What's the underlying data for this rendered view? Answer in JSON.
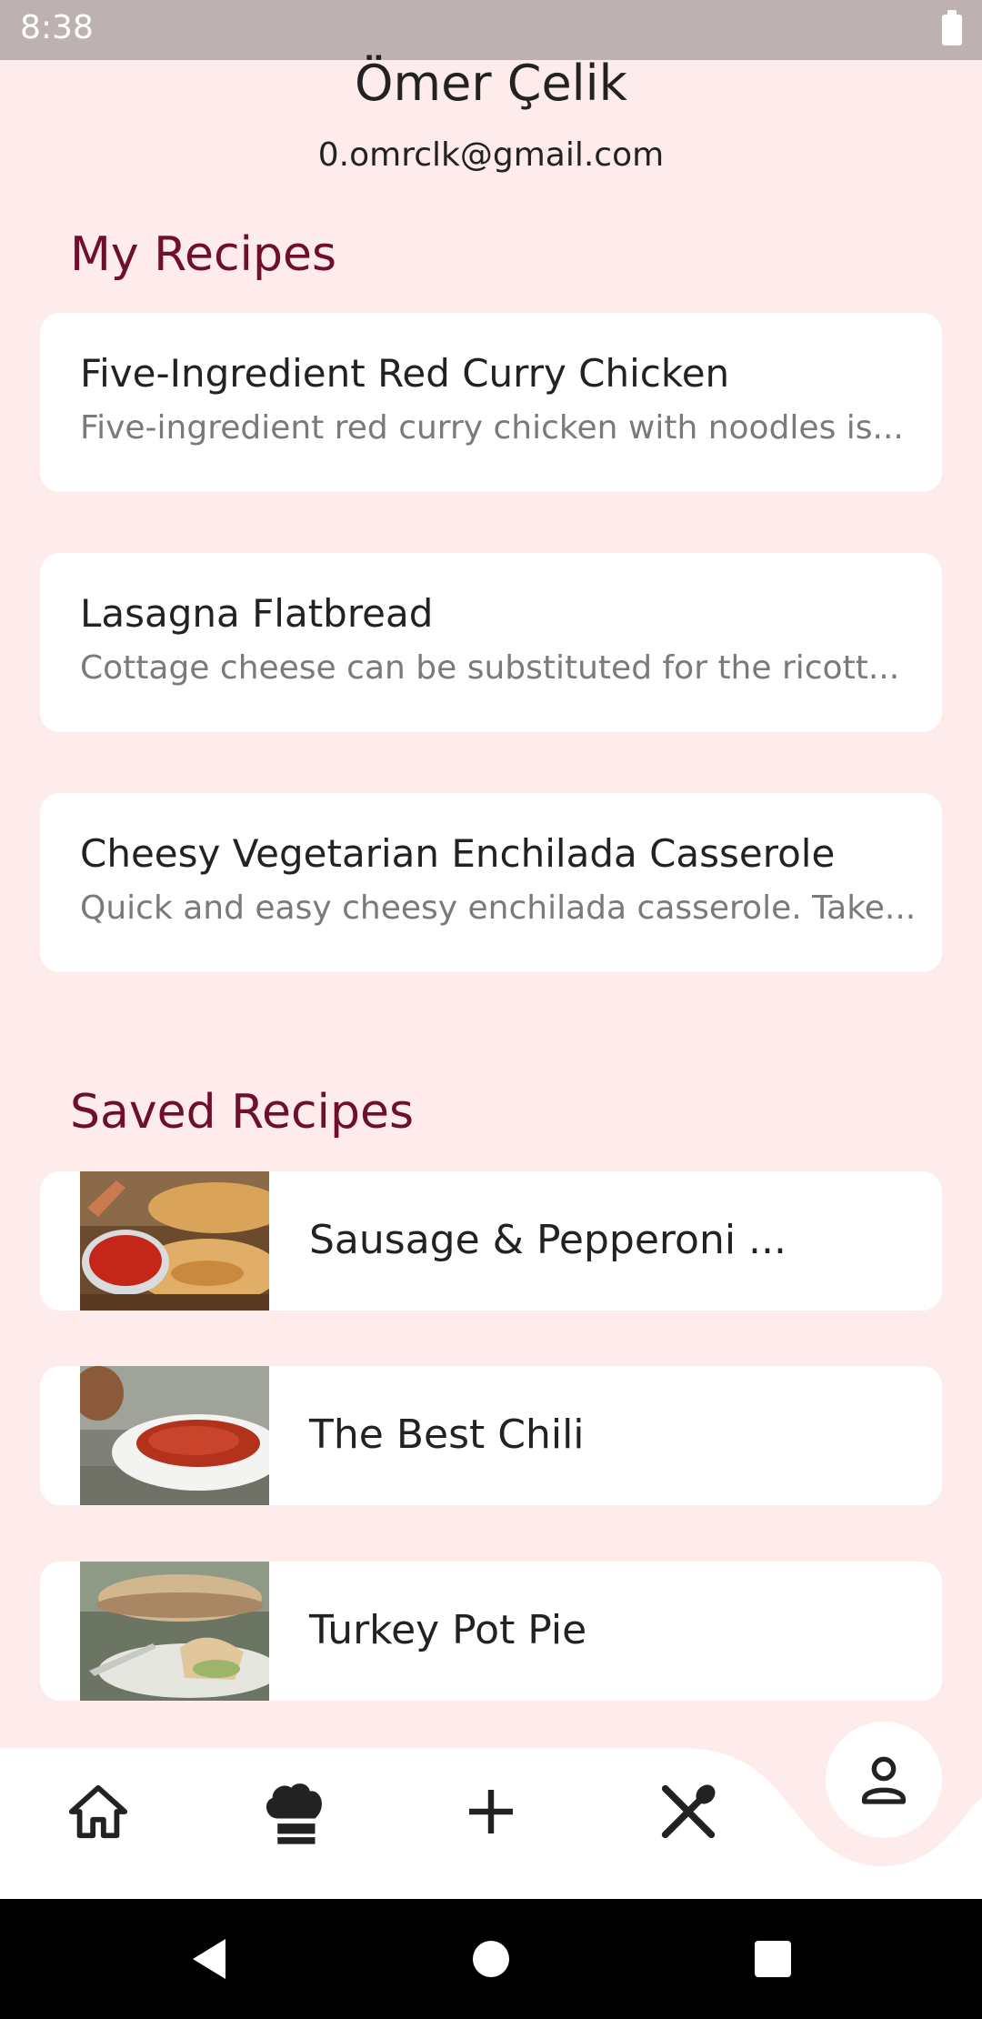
{
  "status_bar": {
    "time": "8:38"
  },
  "profile": {
    "name": "Ömer Çelik",
    "email": "0.omrclk@gmail.com"
  },
  "my_recipes": {
    "heading": "My Recipes",
    "items": [
      {
        "title": "Five-Ingredient Red Curry Chicken",
        "description": "Five-ingredient red curry chicken with noodles is..."
      },
      {
        "title": "Lasagna Flatbread",
        "description": "Cottage cheese can be substituted for the ricott..."
      },
      {
        "title": "Cheesy Vegetarian Enchilada Casserole",
        "description": "Quick and easy cheesy enchilada casserole. Take..."
      }
    ]
  },
  "saved_recipes": {
    "heading": "Saved Recipes",
    "items": [
      {
        "title": "Sausage & Pepperoni ...",
        "image": "stromboli-photo"
      },
      {
        "title": "The Best Chili",
        "image": "chili-bowl-photo"
      },
      {
        "title": "Turkey Pot Pie",
        "image": "pot-pie-photo"
      }
    ]
  },
  "bottom_nav": {
    "items": [
      "home-icon",
      "chef-hat-icon",
      "plus-icon",
      "utensils-icon",
      "profile-icon"
    ],
    "active": "profile-icon"
  },
  "colors": {
    "background": "#fdeceb",
    "accent": "#6e0f2e",
    "card": "#ffffff",
    "status_bar": "#bdb1b1"
  }
}
